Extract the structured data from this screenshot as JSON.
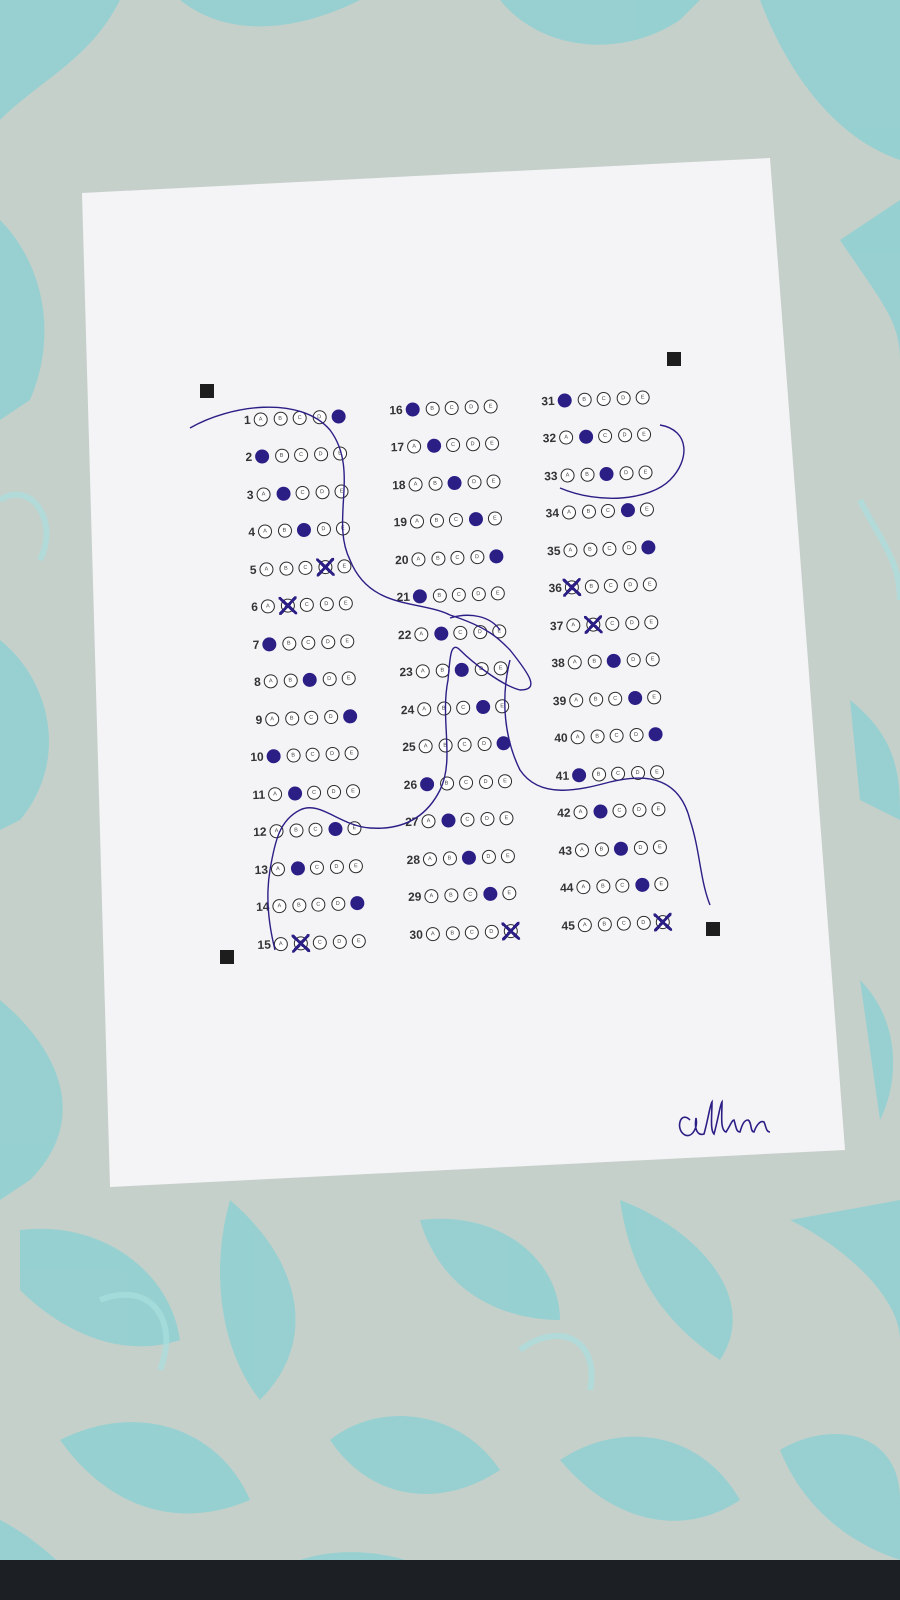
{
  "scene": {
    "subject": "optical answer sheet on a patterned cloth",
    "colors": {
      "cloth_base": "#c8d2cc",
      "cloth_pattern": "#8fcfcf",
      "paper": "#f4f3f6",
      "ink": "#2b1f86",
      "bubble_outline": "#2a2a2a",
      "fiducial": "#1d1d1d"
    }
  },
  "answer_sheet": {
    "option_letters": [
      "A",
      "B",
      "C",
      "D",
      "E"
    ],
    "columns": [
      {
        "rows": [
          {
            "number": "1",
            "filled": [
              4
            ],
            "crossed": []
          },
          {
            "number": "2",
            "filled": [
              0
            ],
            "crossed": []
          },
          {
            "number": "3",
            "filled": [
              1
            ],
            "crossed": []
          },
          {
            "number": "4",
            "filled": [
              2
            ],
            "crossed": []
          },
          {
            "number": "5",
            "filled": [],
            "crossed": [
              3
            ]
          },
          {
            "number": "6",
            "filled": [],
            "crossed": [
              1
            ]
          },
          {
            "number": "7",
            "filled": [
              0
            ],
            "crossed": []
          },
          {
            "number": "8",
            "filled": [
              2
            ],
            "crossed": []
          },
          {
            "number": "9",
            "filled": [
              4
            ],
            "crossed": []
          },
          {
            "number": "10",
            "filled": [
              0
            ],
            "crossed": []
          },
          {
            "number": "11",
            "filled": [
              1
            ],
            "crossed": []
          },
          {
            "number": "12",
            "filled": [
              3
            ],
            "crossed": []
          },
          {
            "number": "13",
            "filled": [
              1
            ],
            "crossed": []
          },
          {
            "number": "14",
            "filled": [
              4
            ],
            "crossed": []
          },
          {
            "number": "15",
            "filled": [],
            "crossed": [
              1
            ]
          }
        ]
      },
      {
        "rows": [
          {
            "number": "16",
            "filled": [
              0
            ],
            "crossed": []
          },
          {
            "number": "17",
            "filled": [
              1
            ],
            "crossed": []
          },
          {
            "number": "18",
            "filled": [
              2
            ],
            "crossed": []
          },
          {
            "number": "19",
            "filled": [
              3
            ],
            "crossed": []
          },
          {
            "number": "20",
            "filled": [
              4
            ],
            "crossed": []
          },
          {
            "number": "21",
            "filled": [
              0
            ],
            "crossed": []
          },
          {
            "number": "22",
            "filled": [
              1
            ],
            "crossed": []
          },
          {
            "number": "23",
            "filled": [
              2
            ],
            "crossed": []
          },
          {
            "number": "24",
            "filled": [
              3
            ],
            "crossed": []
          },
          {
            "number": "25",
            "filled": [
              4
            ],
            "crossed": []
          },
          {
            "number": "26",
            "filled": [
              0
            ],
            "crossed": []
          },
          {
            "number": "27",
            "filled": [
              1
            ],
            "crossed": []
          },
          {
            "number": "28",
            "filled": [
              2
            ],
            "crossed": []
          },
          {
            "number": "29",
            "filled": [
              3
            ],
            "crossed": []
          },
          {
            "number": "30",
            "filled": [],
            "crossed": [
              4
            ]
          }
        ]
      },
      {
        "rows": [
          {
            "number": "31",
            "filled": [
              0
            ],
            "crossed": []
          },
          {
            "number": "32",
            "filled": [
              1
            ],
            "crossed": []
          },
          {
            "number": "33",
            "filled": [
              2
            ],
            "crossed": []
          },
          {
            "number": "34",
            "filled": [
              3
            ],
            "crossed": []
          },
          {
            "number": "35",
            "filled": [
              4
            ],
            "crossed": []
          },
          {
            "number": "36",
            "filled": [],
            "crossed": [
              0
            ]
          },
          {
            "number": "37",
            "filled": [],
            "crossed": [
              1
            ]
          },
          {
            "number": "38",
            "filled": [
              2
            ],
            "crossed": []
          },
          {
            "number": "39",
            "filled": [
              3
            ],
            "crossed": []
          },
          {
            "number": "40",
            "filled": [
              4
            ],
            "crossed": []
          },
          {
            "number": "41",
            "filled": [
              0
            ],
            "crossed": []
          },
          {
            "number": "42",
            "filled": [
              1
            ],
            "crossed": []
          },
          {
            "number": "43",
            "filled": [
              2
            ],
            "crossed": []
          },
          {
            "number": "44",
            "filled": [
              3
            ],
            "crossed": []
          },
          {
            "number": "45",
            "filled": [],
            "crossed": [
              4
            ]
          }
        ]
      }
    ]
  },
  "signature": {
    "text": "allan"
  }
}
